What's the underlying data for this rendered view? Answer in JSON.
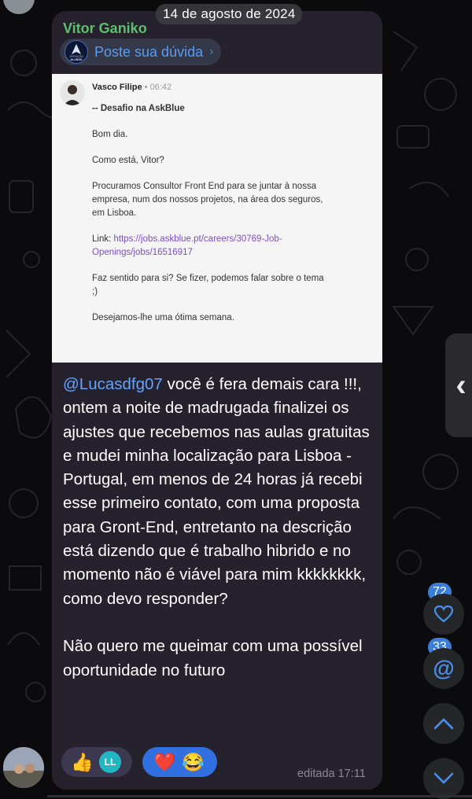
{
  "date_label": "14 de agosto de 2024",
  "message": {
    "sender": "Vitor Ganiko",
    "channel": {
      "name": "Poste sua dúvida"
    },
    "logo_text": {
      "line1": "OPERAÇÃO",
      "line2": "ALUNOS"
    },
    "embedded_email": {
      "sender": "Vasco Filipe",
      "time": "• 06:42",
      "subject": "-- Desafio na AskBlue",
      "greeting": "Bom dia.",
      "question": "Como está, Vitor?",
      "offer": "Procuramos Consultor Front End para se juntar à nossa empresa, num dos nossos projetos, na área dos seguros, em Lisboa.",
      "link_label": "Link: ",
      "link_url": "https://jobs.askblue.pt/careers/30769-Job-Openings/jobs/16516917",
      "follow_up": "Faz sentido para si? Se fizer, podemos falar sobre o tema ;)",
      "closing": "Desejamos-lhe uma ótima semana."
    },
    "mention": "@Lucasdfg07",
    "text": " você é fera demais cara !!!, ontem a noite de madrugada finalizei os ajustes que recebemos nas aulas gratuitas e mudei minha localização para Lisboa - Portugal, em menos de 24 horas já recebi esse primeiro contato, com uma proposta para Gront-End, entretanto na descrição está dizendo que é trabalho hibrido e no momento não é viável para mim kkkkkkkk, como devo responder?\n\nNão quero me queimar com uma possível oportunidade no futuro",
    "reactions": [
      {
        "emoji": "👍",
        "reactor_initials": "LL"
      },
      {
        "emoji": "❤️",
        "reactor_emoji": "😂"
      }
    ],
    "edited_label": "editada 17:11"
  },
  "floating": {
    "reactions_count": "72",
    "mentions_count": "33"
  },
  "icons": [
    "chevron-right-icon",
    "heart-icon",
    "at-icon",
    "chevron-up-icon",
    "chevron-down-icon",
    "side-panel-chevron-icon"
  ],
  "colors": {
    "background": "#0b0b0d",
    "bubble": "#25222d",
    "sender": "#5fc06b",
    "mention": "#65a2ff",
    "badge": "#3b7ed8",
    "reaction_active": "#3070e0"
  }
}
